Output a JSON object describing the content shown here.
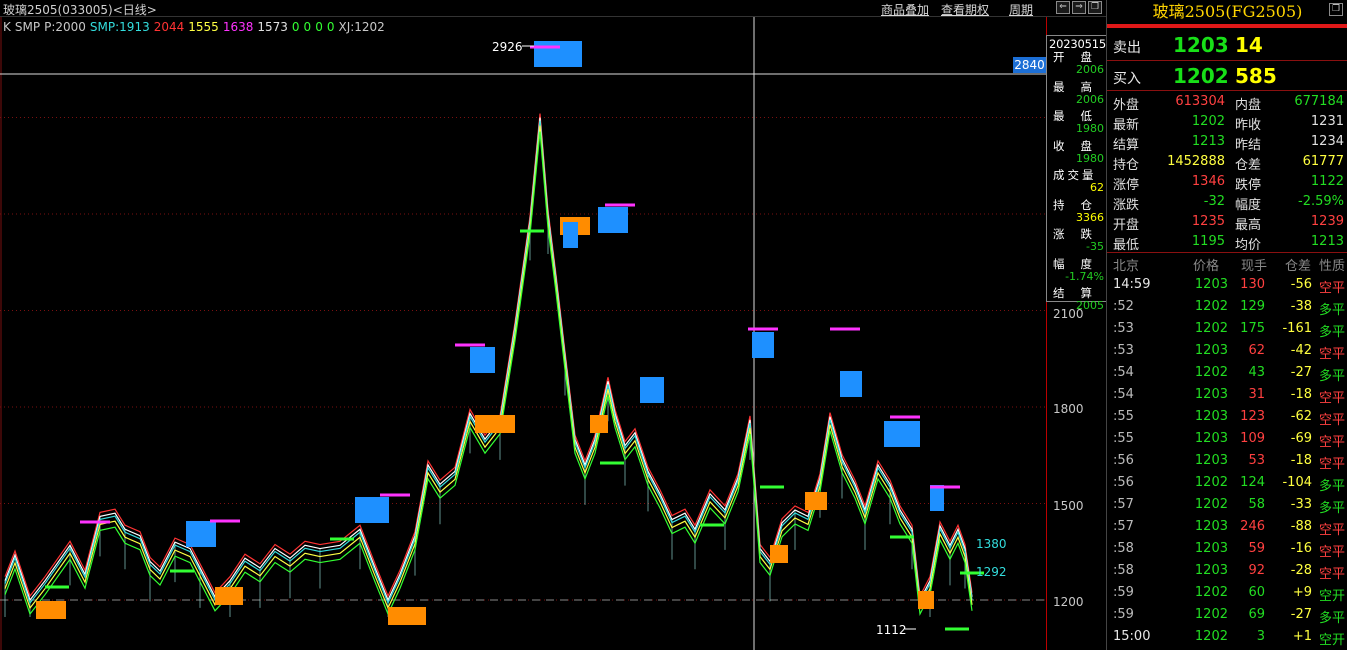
{
  "top": {
    "title": "玻璃2505(033005)<日线>",
    "links": [
      "商品叠加",
      "查看期权",
      "周期"
    ]
  },
  "indicators": [
    {
      "text": "K",
      "color": "#c8c8c8"
    },
    {
      "text": "SMP",
      "color": "#c8c8c8"
    },
    {
      "text": "P:2000",
      "color": "#c8c8c8"
    },
    {
      "text": "SMP:1913",
      "color": "#33dddd"
    },
    {
      "text": "2044",
      "color": "#ff3333"
    },
    {
      "text": "1555",
      "color": "#ffff44"
    },
    {
      "text": "1638",
      "color": "#ff33ff"
    },
    {
      "text": "1573",
      "color": "#e0e0e0"
    },
    {
      "text": "0",
      "color": "#33ff33"
    },
    {
      "text": "0",
      "color": "#33ff33"
    },
    {
      "text": "0",
      "color": "#33ff33"
    },
    {
      "text": "0",
      "color": "#33ff33"
    },
    {
      "text": "XJ:1202",
      "color": "#c8c8c8"
    }
  ],
  "axis": {
    "labels": [
      "2100",
      "1800",
      "1500",
      "1200"
    ],
    "crosshair_value": "2840"
  },
  "annotations": {
    "high": "2926",
    "low": "1112",
    "right1": "1380",
    "right2": "1292"
  },
  "data_window": {
    "date": "20230515",
    "items": [
      {
        "label": "开盘",
        "value": "2006",
        "color": "#22cc22"
      },
      {
        "label": "最高",
        "value": "2006",
        "color": "#22cc22"
      },
      {
        "label": "最低",
        "value": "1980",
        "color": "#22cc22"
      },
      {
        "label": "收盘",
        "value": "1980",
        "color": "#22cc22"
      },
      {
        "label": "成交量",
        "value": "62",
        "color": "#ffff00"
      },
      {
        "label": "持仓",
        "value": "3366",
        "color": "#ffff00"
      },
      {
        "label": "涨跌",
        "value": "-35",
        "color": "#22cc22"
      },
      {
        "label": "幅度",
        "value": "-1.74%",
        "color": "#22cc22"
      },
      {
        "label": "结算",
        "value": "2005",
        "color": "#22cc22"
      }
    ]
  },
  "panel": {
    "title": "玻璃2505(FG2505)",
    "sell": {
      "label": "卖出",
      "price": "1203",
      "volume": "14"
    },
    "buy": {
      "label": "买入",
      "price": "1202",
      "volume": "585"
    },
    "stats": [
      [
        "外盘",
        "613304",
        "#ff4040",
        "内盘",
        "677184",
        "#22dd22"
      ],
      [
        "最新",
        "1202",
        "#22dd22",
        "昨收",
        "1231",
        "#e0e0e0"
      ],
      [
        "结算",
        "1213",
        "#22dd22",
        "昨结",
        "1234",
        "#e0e0e0"
      ],
      [
        "持仓",
        "1452888",
        "#ffff40",
        "仓差",
        "61777",
        "#ffff40"
      ],
      [
        "涨停",
        "1346",
        "#ff4040",
        "跌停",
        "1122",
        "#22dd22"
      ],
      [
        "涨跌",
        "-32",
        "#22dd22",
        "幅度",
        "-2.59%",
        "#22dd22"
      ],
      [
        "开盘",
        "1235",
        "#ff4040",
        "最高",
        "1239",
        "#ff4040"
      ],
      [
        "最低",
        "1195",
        "#22dd22",
        "均价",
        "1213",
        "#22dd22"
      ]
    ],
    "tick_header": [
      "北京",
      "价格",
      "现手",
      "仓差",
      "性质"
    ],
    "ticks": [
      [
        "14:59",
        "1203",
        "130",
        "-56",
        "空平",
        "#ff4040"
      ],
      [
        ":52",
        "1202",
        "129",
        "-38",
        "多平",
        "#22dd22"
      ],
      [
        ":53",
        "1202",
        "175",
        "-161",
        "多平",
        "#22dd22"
      ],
      [
        ":53",
        "1203",
        "62",
        "-42",
        "空平",
        "#ff4040"
      ],
      [
        ":54",
        "1202",
        "43",
        "-27",
        "多平",
        "#22dd22"
      ],
      [
        ":54",
        "1203",
        "31",
        "-18",
        "空平",
        "#ff4040"
      ],
      [
        ":55",
        "1203",
        "123",
        "-62",
        "空平",
        "#ff4040"
      ],
      [
        ":55",
        "1203",
        "109",
        "-69",
        "空平",
        "#ff4040"
      ],
      [
        ":56",
        "1203",
        "53",
        "-18",
        "空平",
        "#ff4040"
      ],
      [
        ":56",
        "1202",
        "124",
        "-104",
        "多平",
        "#22dd22"
      ],
      [
        ":57",
        "1202",
        "58",
        "-33",
        "多平",
        "#22dd22"
      ],
      [
        ":57",
        "1203",
        "246",
        "-88",
        "空平",
        "#ff4040"
      ],
      [
        ":58",
        "1203",
        "59",
        "-16",
        "空平",
        "#ff4040"
      ],
      [
        ":58",
        "1203",
        "92",
        "-28",
        "空平",
        "#ff4040"
      ],
      [
        ":59",
        "1202",
        "60",
        "+9",
        "空开",
        "#22dd22"
      ],
      [
        ":59",
        "1202",
        "69",
        "-27",
        "多平",
        "#22dd22"
      ],
      [
        "15:00",
        "1202",
        "3",
        "+1",
        "空开",
        "#22dd22"
      ]
    ]
  }
}
